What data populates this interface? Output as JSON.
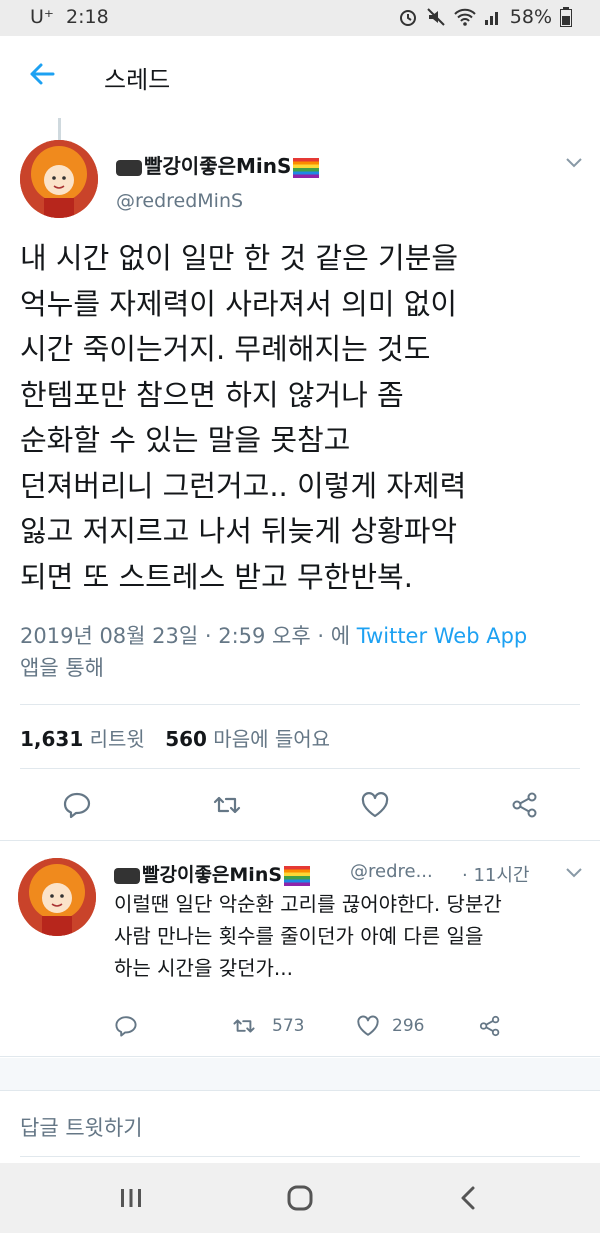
{
  "status_bar": {
    "carrier": "U⁺",
    "time": "2:18",
    "battery": "58%"
  },
  "header": {
    "title": "스레드"
  },
  "tweet": {
    "display_name": "빨강이좋은MinS",
    "handle": "@redredMinS",
    "lines": [
      "내 시간 없이 일만 한 것 같은 기분을",
      "억누를 자제력이 사라져서 의미 없이",
      "시간 죽이는거지. 무례해지는 것도",
      "한템포만 참으면 하지 않거나 좀",
      "순화할 수 있는 말을 못참고",
      "던져버리니 그런거고.. 이렇게 자제력",
      "잃고 저지르고 나서 뒤늦게 상황파악",
      "되면 또 스트레스 받고 무한반복."
    ],
    "meta_date": "2019년 08월 23일 · 2:59 오후 · 에 ",
    "meta_source": "Twitter Web App",
    "meta_suffix": "앱을 통해",
    "retweets_count": "1,631",
    "retweets_label": "리트윗",
    "likes_count": "560",
    "likes_label": "마음에 들어요"
  },
  "reply": {
    "display_name": "빨강이좋은MinS",
    "handle": "@redre...",
    "time": "· 11시간",
    "lines": [
      "이럴땐 일단 악순환 고리를 끊어야한다. 당분간",
      "사람 만나는 횟수를 줄이던가 아예 다른 일을",
      "하는 시간을 갖던가..."
    ],
    "retweets": "573",
    "likes": "296"
  },
  "compose": {
    "placeholder": "답글 트윗하기"
  },
  "colors": {
    "accent": "#1da1f2",
    "secondary_text": "#657786",
    "primary_text": "#14171a"
  }
}
